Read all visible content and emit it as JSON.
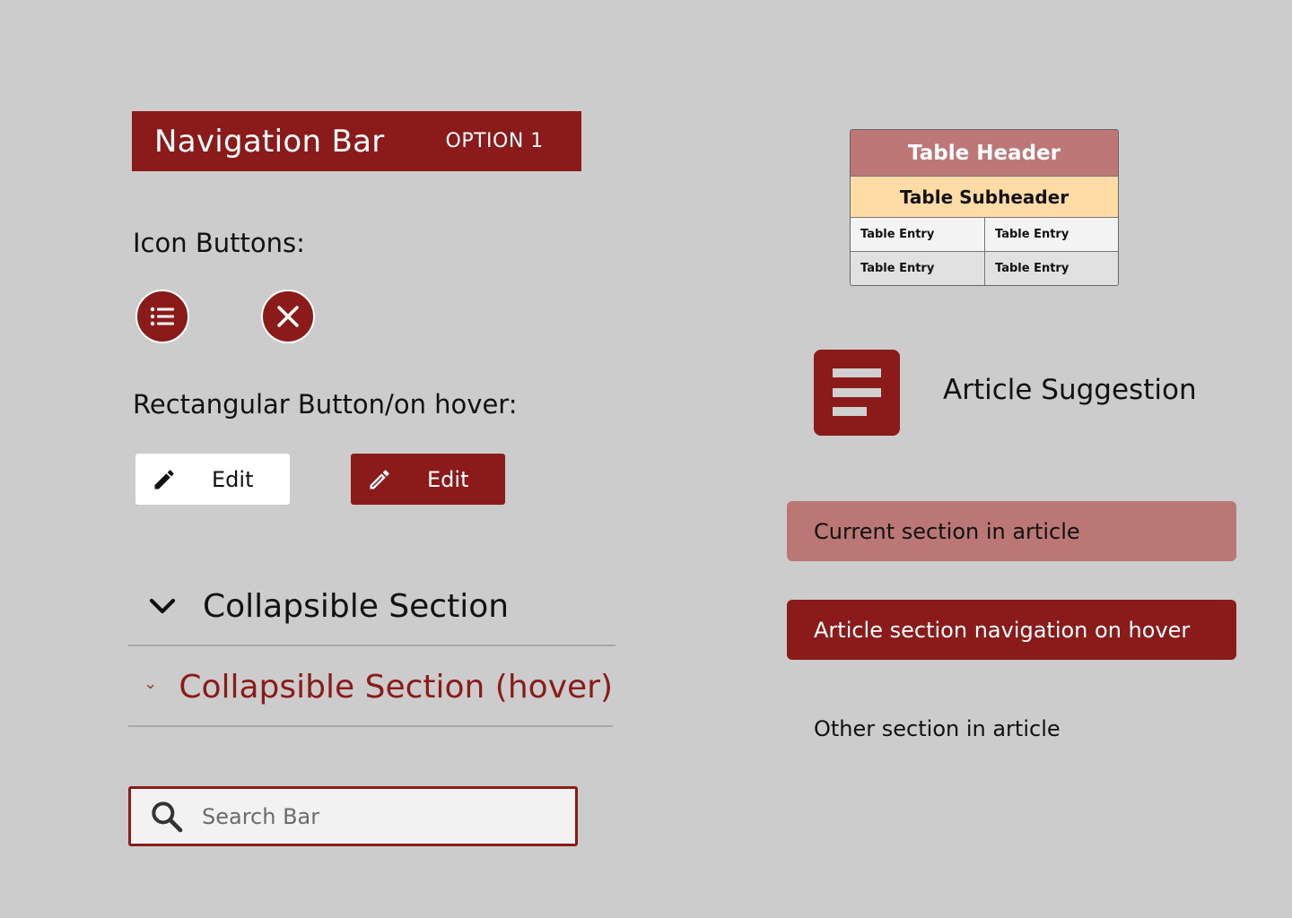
{
  "navbar": {
    "title": "Navigation Bar",
    "option": "OPTION 1"
  },
  "icon_buttons": {
    "label": "Icon Buttons:",
    "items": [
      {
        "icon": "list-icon"
      },
      {
        "icon": "close-icon"
      }
    ]
  },
  "rect_buttons": {
    "label": "Rectangular Button/on hover:",
    "normal": {
      "label": "Edit",
      "icon": "pencil-icon"
    },
    "hover": {
      "label": "Edit",
      "icon": "pencil-icon"
    }
  },
  "collapsibles": [
    {
      "label": "Collapsible Section",
      "color": "#111111"
    },
    {
      "label": "Collapsible Section (hover)",
      "color": "#8b1a1a"
    }
  ],
  "search": {
    "placeholder": "Search Bar",
    "value": ""
  },
  "table": {
    "header": "Table Header",
    "subheader": "Table Subheader",
    "rows": [
      [
        "Table Entry",
        "Table Entry"
      ],
      [
        "Table Entry",
        "Table Entry"
      ]
    ],
    "colors": {
      "header": "#bd7777",
      "subheader": "#ffdca5"
    }
  },
  "article_suggestion": {
    "label": "Article Suggestion",
    "icon": "document-icon"
  },
  "sections": {
    "current": "Current section in article",
    "hover": "Article section navigation on hover",
    "other": "Other section in article"
  },
  "colors": {
    "accent": "#8b1a1a",
    "background": "#cccccc"
  }
}
